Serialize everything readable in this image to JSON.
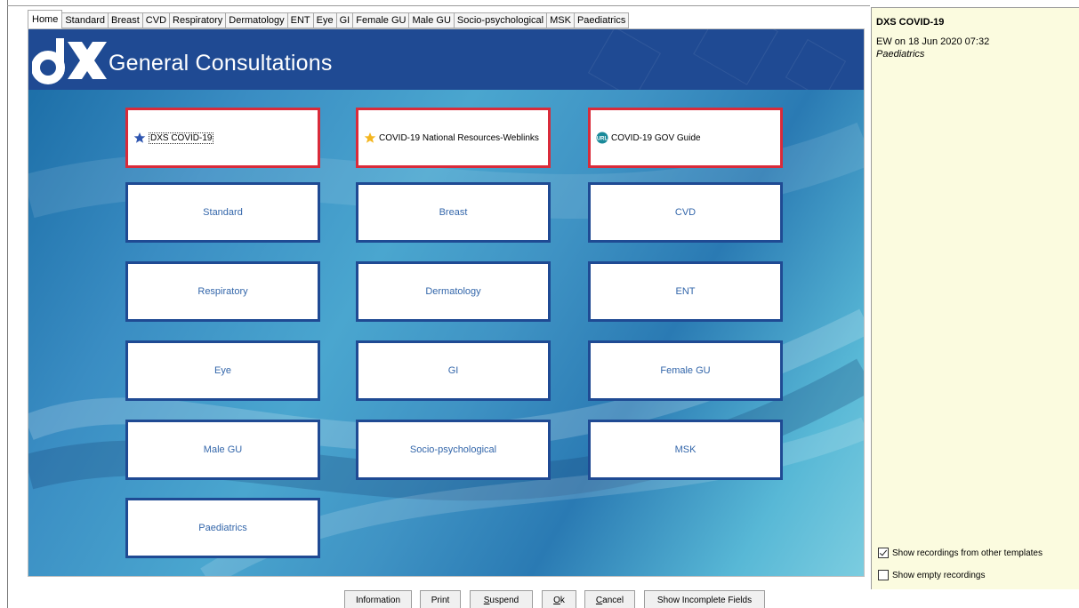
{
  "tabs": [
    "Home",
    "Standard",
    "Breast",
    "CVD",
    "Respiratory",
    "Dermatology",
    "ENT",
    "Eye",
    "GI",
    "Female GU",
    "Male GU",
    "Socio-psychological",
    "MSK",
    "Paediatrics"
  ],
  "active_tab": "Home",
  "header": {
    "title": "General Consultations",
    "logo_icon": "dx-logo-icon"
  },
  "tiles": {
    "dxs_covid": "DXS COVID-19",
    "national_resources": "COVID-19 National Resources-Weblinks",
    "gov_guide": "COVID-19 GOV Guide",
    "gov_guide_icon_text": "URL",
    "standard": "Standard",
    "breast": "Breast",
    "cvd": "CVD",
    "respiratory": "Respiratory",
    "dermatology": "Dermatology",
    "ent": "ENT",
    "eye": "Eye",
    "gi": "GI",
    "female_gu": "Female GU",
    "male_gu": "Male GU",
    "socio": "Socio-psychological",
    "msk": "MSK",
    "paediatrics": "Paediatrics"
  },
  "buttons": {
    "information": "Information",
    "print": "Print",
    "suspend_u": "S",
    "suspend_rest": "uspend",
    "ok_u": "O",
    "ok_rest": "k",
    "cancel_u": "C",
    "cancel_rest": "ancel",
    "show_incomplete": "Show Incomplete Fields"
  },
  "side": {
    "title": "DXS COVID-19",
    "meta": "EW on 18 Jun 2020 07:32",
    "subtitle": "Paediatrics",
    "show_other_label": "Show recordings from other templates",
    "show_other_checked": true,
    "show_empty_label": "Show empty recordings",
    "show_empty_checked": false
  },
  "colors": {
    "header_blue": "#1f4a93",
    "tile_border_blue": "#1f4a93",
    "tile_border_red": "#d92b3a",
    "tile_text": "#3366aa",
    "side_bg": "#fbfbdf"
  }
}
